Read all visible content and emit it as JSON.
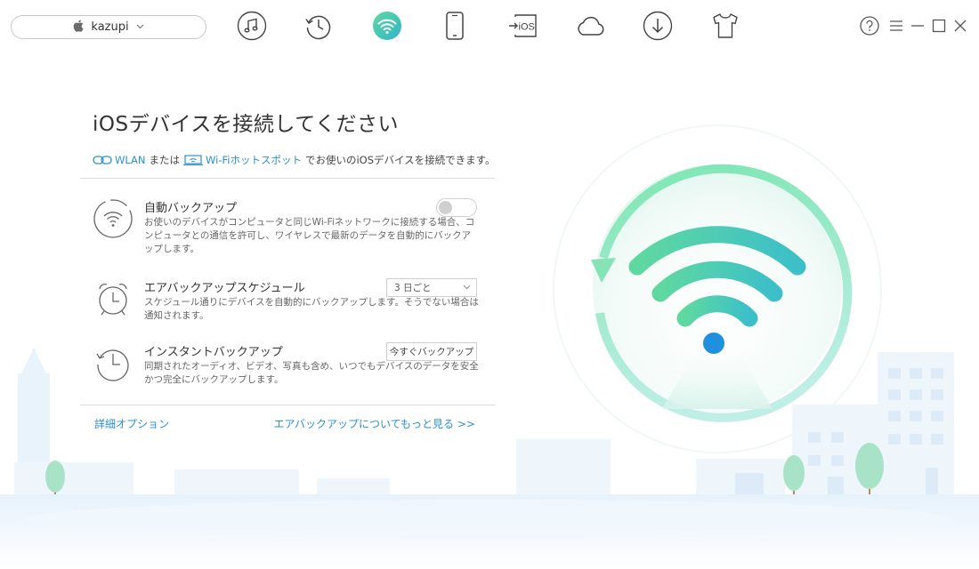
{
  "device": {
    "name": "kazupi",
    "icon": "apple-icon"
  },
  "toolbar": {
    "tools": [
      {
        "name": "music-icon"
      },
      {
        "name": "history-icon"
      },
      {
        "name": "wifi-icon",
        "active": true
      },
      {
        "name": "phone-icon"
      },
      {
        "name": "ios-transfer-icon",
        "text": "iOS"
      },
      {
        "name": "cloud-icon"
      },
      {
        "name": "download-icon"
      },
      {
        "name": "tshirt-icon"
      }
    ]
  },
  "window_controls": [
    "help-icon",
    "menu-icon",
    "minimize-icon",
    "maximize-icon",
    "close-icon"
  ],
  "main": {
    "title": "iOSデバイスを接続してください",
    "subtitle": {
      "wlan": "WLAN",
      "or": "または",
      "hotspot": "Wi-Fiホットスポット",
      "rest": "でお使いのiOSデバイスを接続できます。"
    },
    "options": [
      {
        "title": "自動バックアップ",
        "desc": "お使いのデバイスがコンピュータと同じWi-Fiネットワークに接続する場合、コンピュータとの通信を許可し、ワイヤレスで最新のデータを自動的にバックアップします。",
        "control": "toggle",
        "enabled": false
      },
      {
        "title": "エアバックアップスケジュール",
        "desc": "スケジュール通りにデバイスを自動的にバックアップします。そうでない場合は通知されます。",
        "control": "select",
        "value": "3 日ごと"
      },
      {
        "title": "インスタントバックアップ",
        "desc": "同期されたオーディオ、ビデオ、写真も含め、いつでもデバイスのデータを安全かつ完全にバックアップします。",
        "control": "button",
        "button_label": "今すぐバックアップ"
      }
    ],
    "footer": {
      "advanced": "詳細オプション",
      "learn_more": "エアバックアップについてもっと見る >>"
    }
  },
  "colors": {
    "accent": "#2a8fd6",
    "wifi_green": "#5fd8a0",
    "wifi_teal": "#3cbfc9",
    "wifi_dot": "#1f8fde"
  }
}
